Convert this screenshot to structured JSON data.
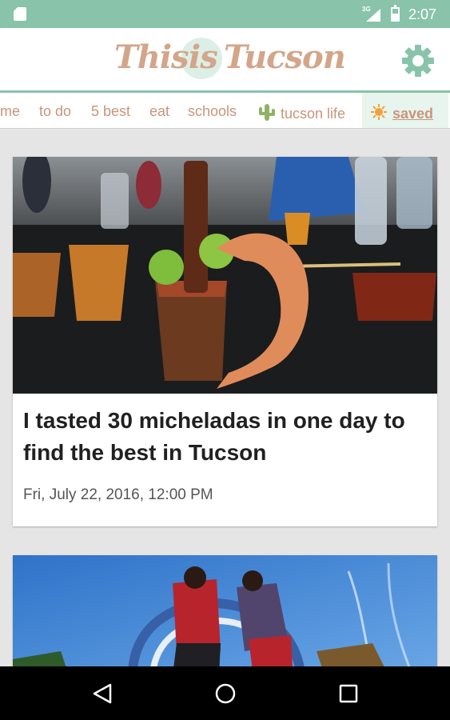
{
  "status_bar": {
    "network": "3G",
    "time": "2:07",
    "icons": [
      "sd-card-icon",
      "signal-icon",
      "battery-icon"
    ]
  },
  "header": {
    "logo": {
      "word1": "This",
      "word2": "is",
      "word3": "Tucson"
    },
    "settings_icon": "gear-icon"
  },
  "tabs": [
    {
      "label": "me"
    },
    {
      "label": "to do"
    },
    {
      "label": "5 best"
    },
    {
      "label": "eat"
    },
    {
      "label": "schools"
    },
    {
      "label": "tucson life",
      "icon": "cactus-icon"
    },
    {
      "label": "saved",
      "icon": "sun-icon",
      "selected": true
    }
  ],
  "articles": [
    {
      "headline": "I tasted 30 micheladas in one day to find the best in Tucson",
      "date": "Fri, July 22, 2016, 12:00 PM",
      "image": "michelada-with-shrimp-photo"
    },
    {
      "headline": "",
      "date": "",
      "image": "splash-pad-kids-photo"
    }
  ],
  "nav_bar": {
    "back": "back-icon",
    "home": "home-icon",
    "recents": "recents-icon"
  },
  "colors": {
    "accent": "#88c3aa",
    "brand": "#d3a589",
    "tab_text": "#c9957a",
    "selected_tab_bg": "#e8f4ee"
  }
}
